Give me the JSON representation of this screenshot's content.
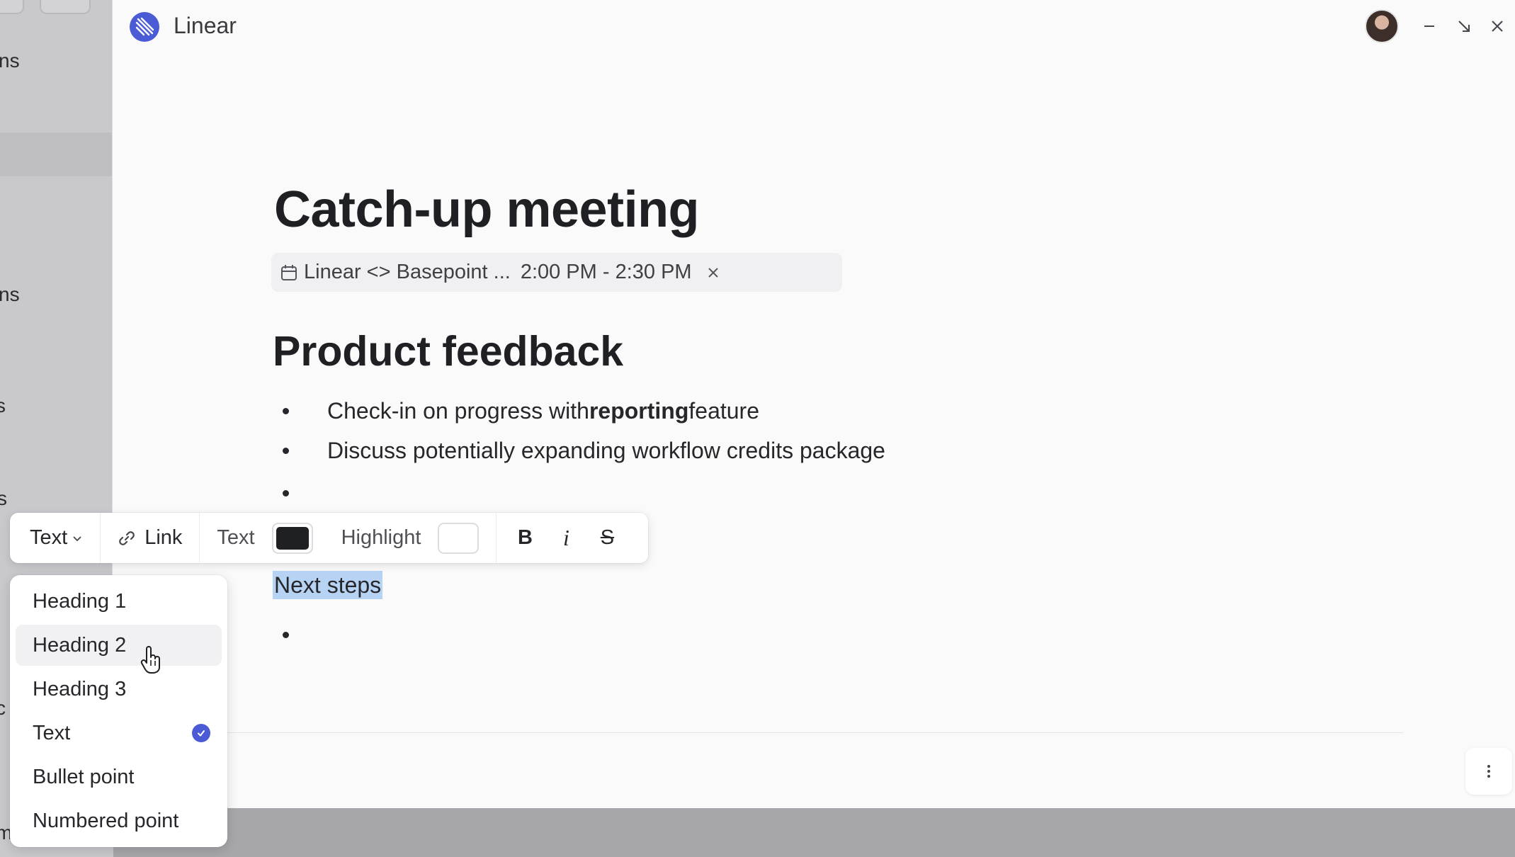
{
  "app": {
    "title": "Linear",
    "accent": "#4b5bd6"
  },
  "window_controls": [
    "minimize-icon",
    "collapse-icon",
    "close-icon"
  ],
  "document": {
    "title": "Catch-up meeting",
    "event": {
      "name": "Linear <> Basepoint ...",
      "time": "2:00 PM - 2:30 PM"
    },
    "heading": "Product feedback",
    "bullets": [
      {
        "before": "Check-in on progress with ",
        "bold": "reporting",
        "after": " feature"
      },
      {
        "text": "Discuss potentially expanding workflow credits package"
      }
    ],
    "selected_text": "Next steps"
  },
  "toolbar": {
    "block_type": "Text",
    "link_label": "Link",
    "text_color_label": "Text",
    "text_color": "#1f2023",
    "highlight_label": "Highlight",
    "highlight_color": "#ffffff",
    "bold": "B",
    "italic": "i",
    "strike": "S"
  },
  "dropdown": {
    "items": [
      "Heading 1",
      "Heading 2",
      "Heading 3",
      "Text",
      "Bullet point",
      "Numbered point"
    ],
    "hovered": "Heading 2",
    "selected": "Text"
  },
  "background_app": {
    "fragments": [
      "ns",
      "ns",
      "s",
      "s",
      "c",
      "m"
    ]
  }
}
